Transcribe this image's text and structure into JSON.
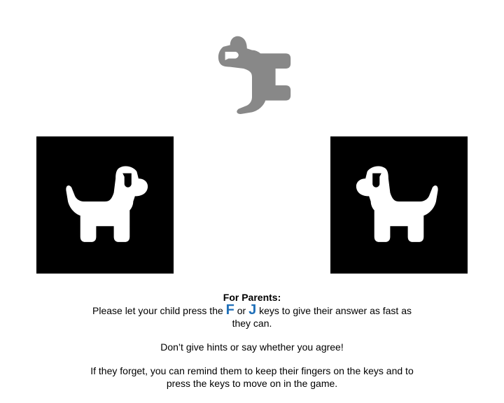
{
  "stimulus": {
    "icon": "dog-icon",
    "color": "#888888",
    "orientation": "rotated"
  },
  "choices": [
    {
      "icon": "dog-icon",
      "background": "#000000",
      "foreground": "#ffffff",
      "facing": "right"
    },
    {
      "icon": "dog-icon",
      "background": "#000000",
      "foreground": "#ffffff",
      "facing": "left"
    }
  ],
  "instructions": {
    "title": "For Parents:",
    "line1_before": "Please let your child press the",
    "key_f": "F",
    "or_text": "or",
    "key_j": "J",
    "line1_after": "keys to give their answer as fast as they can.",
    "line2": "Don’t give hints or say whether you agree!",
    "line3": "If they forget, you can remind them to keep their fingers on the keys and to press the keys to move on in the game."
  },
  "colors": {
    "key_accent": "#1f6fb8"
  }
}
